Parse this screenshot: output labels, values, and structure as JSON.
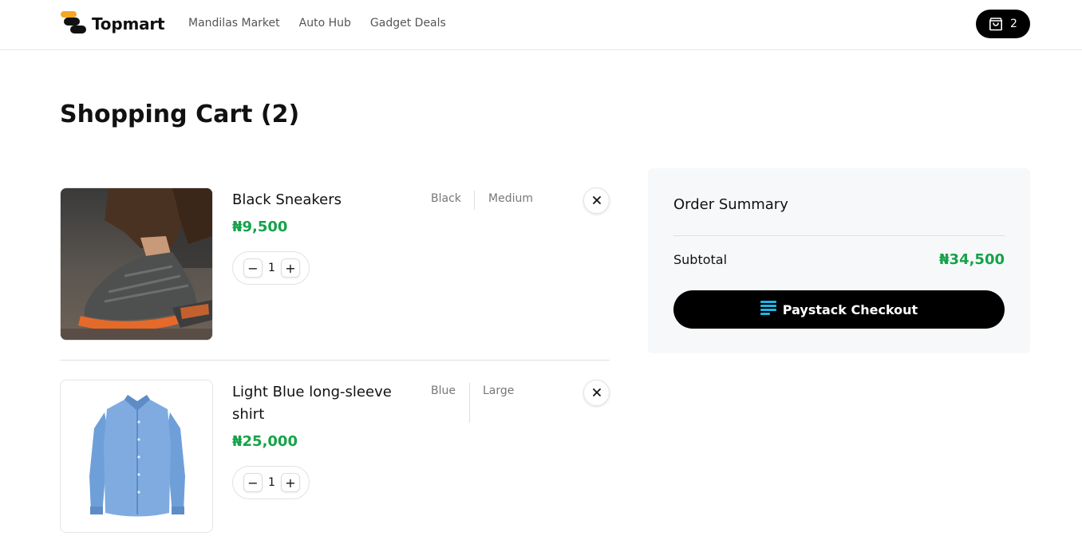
{
  "brand": {
    "name": "Topmart",
    "logo_icon": "topmart-logo-icon",
    "accent_colors": [
      "#f5a623",
      "#111111"
    ]
  },
  "nav": {
    "links": [
      "Mandilas Market",
      "Auto Hub",
      "Gadget Deals"
    ]
  },
  "cart_button": {
    "icon": "shopping-bag-icon",
    "count": "2"
  },
  "page": {
    "title": "Shopping Cart (2)"
  },
  "cart": {
    "items": [
      {
        "name": "Black Sneakers",
        "price": "₦9,500",
        "color": "Black",
        "size": "Medium",
        "quantity": "1",
        "image_icon": "sneaker-product-image"
      },
      {
        "name": "Light Blue long-sleeve shirt",
        "price": "₦25,000",
        "color": "Blue",
        "size": "Large",
        "quantity": "1",
        "image_icon": "shirt-product-image"
      }
    ],
    "decrement_symbol": "−",
    "increment_symbol": "+"
  },
  "summary": {
    "title": "Order Summary",
    "subtotal_label": "Subtotal",
    "subtotal_value": "₦34,500",
    "checkout_label": "Paystack Checkout",
    "checkout_icon": "paystack-icon"
  },
  "colors": {
    "price_green": "#16a34a",
    "button_black": "#000000",
    "paystack_blue": "#1fb5e8"
  }
}
